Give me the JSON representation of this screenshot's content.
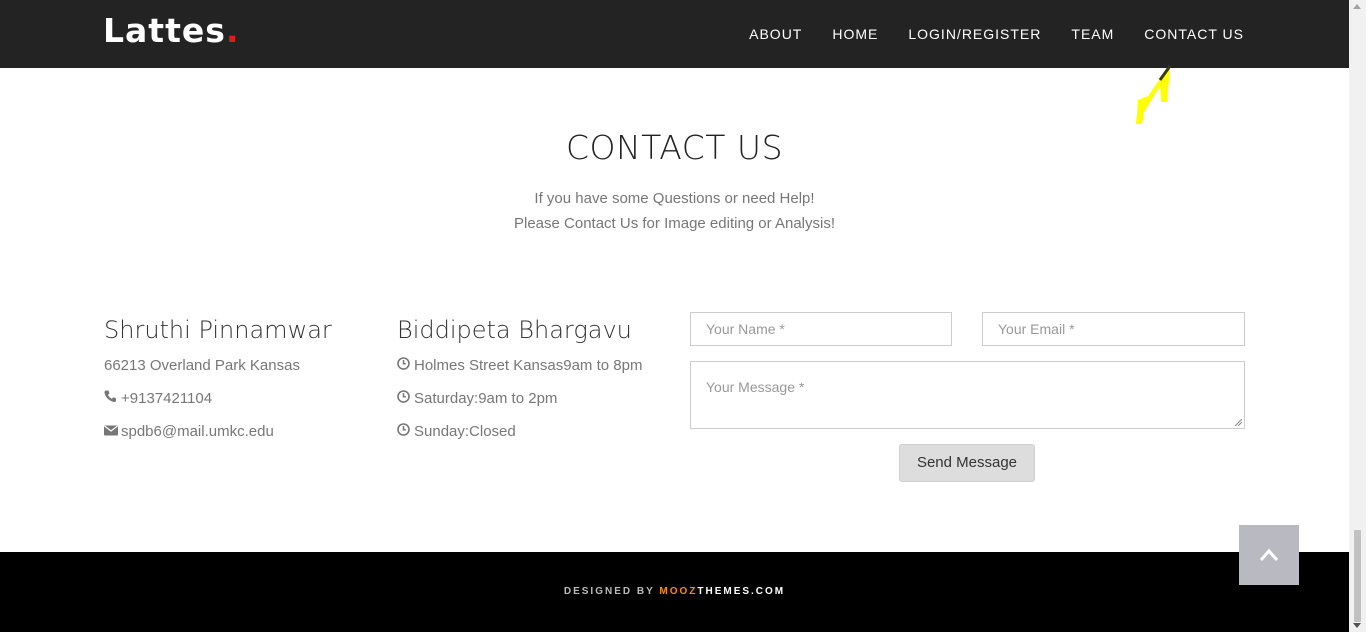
{
  "header": {
    "brand": "Lattes",
    "brand_dot": ".",
    "nav": [
      {
        "label": "ABOUT"
      },
      {
        "label": "HOME"
      },
      {
        "label": "LOGIN/REGISTER"
      },
      {
        "label": "TEAM"
      },
      {
        "label": "CONTACT US"
      }
    ]
  },
  "contact": {
    "title": "CONTACT US",
    "subtitle_line1": "If you have some Questions or need Help!",
    "subtitle_line2": "Please Contact Us for Image editing or Analysis!"
  },
  "person1": {
    "name": "Shruthi Pinnamwar",
    "address": "66213 Overland Park Kansas",
    "phone": "+9137421104",
    "email": "spdb6@mail.umkc.edu",
    "phone_icon": "phone-icon",
    "email_icon": "envelope-icon"
  },
  "person2": {
    "name": "Biddipeta Bhargavu",
    "hours": [
      {
        "text": "Holmes Street Kansas9am to 8pm"
      },
      {
        "text": "Saturday:9am to 2pm"
      },
      {
        "text": "Sunday:Closed"
      }
    ],
    "hours_icon": "clock-icon"
  },
  "form": {
    "name_placeholder": "Your Name *",
    "email_placeholder": "Your Email *",
    "message_placeholder": "Your Message *",
    "send_label": "Send Message"
  },
  "footer": {
    "designed_by": "DESIGNED BY ",
    "brand_accent": "MOOZ",
    "brand_rest": "THEMES.COM"
  },
  "colors": {
    "navbar_bg": "#232323",
    "brand_dot": "#e21a1a",
    "footer_bg": "#000000",
    "footer_accent": "#f58c1c",
    "annotation": "#ffff00",
    "back_to_top_bg": "#b9b9c1"
  },
  "icons": {
    "back_to_top": "chevron-up-icon",
    "annotation": "arrow-annotation-icon"
  }
}
